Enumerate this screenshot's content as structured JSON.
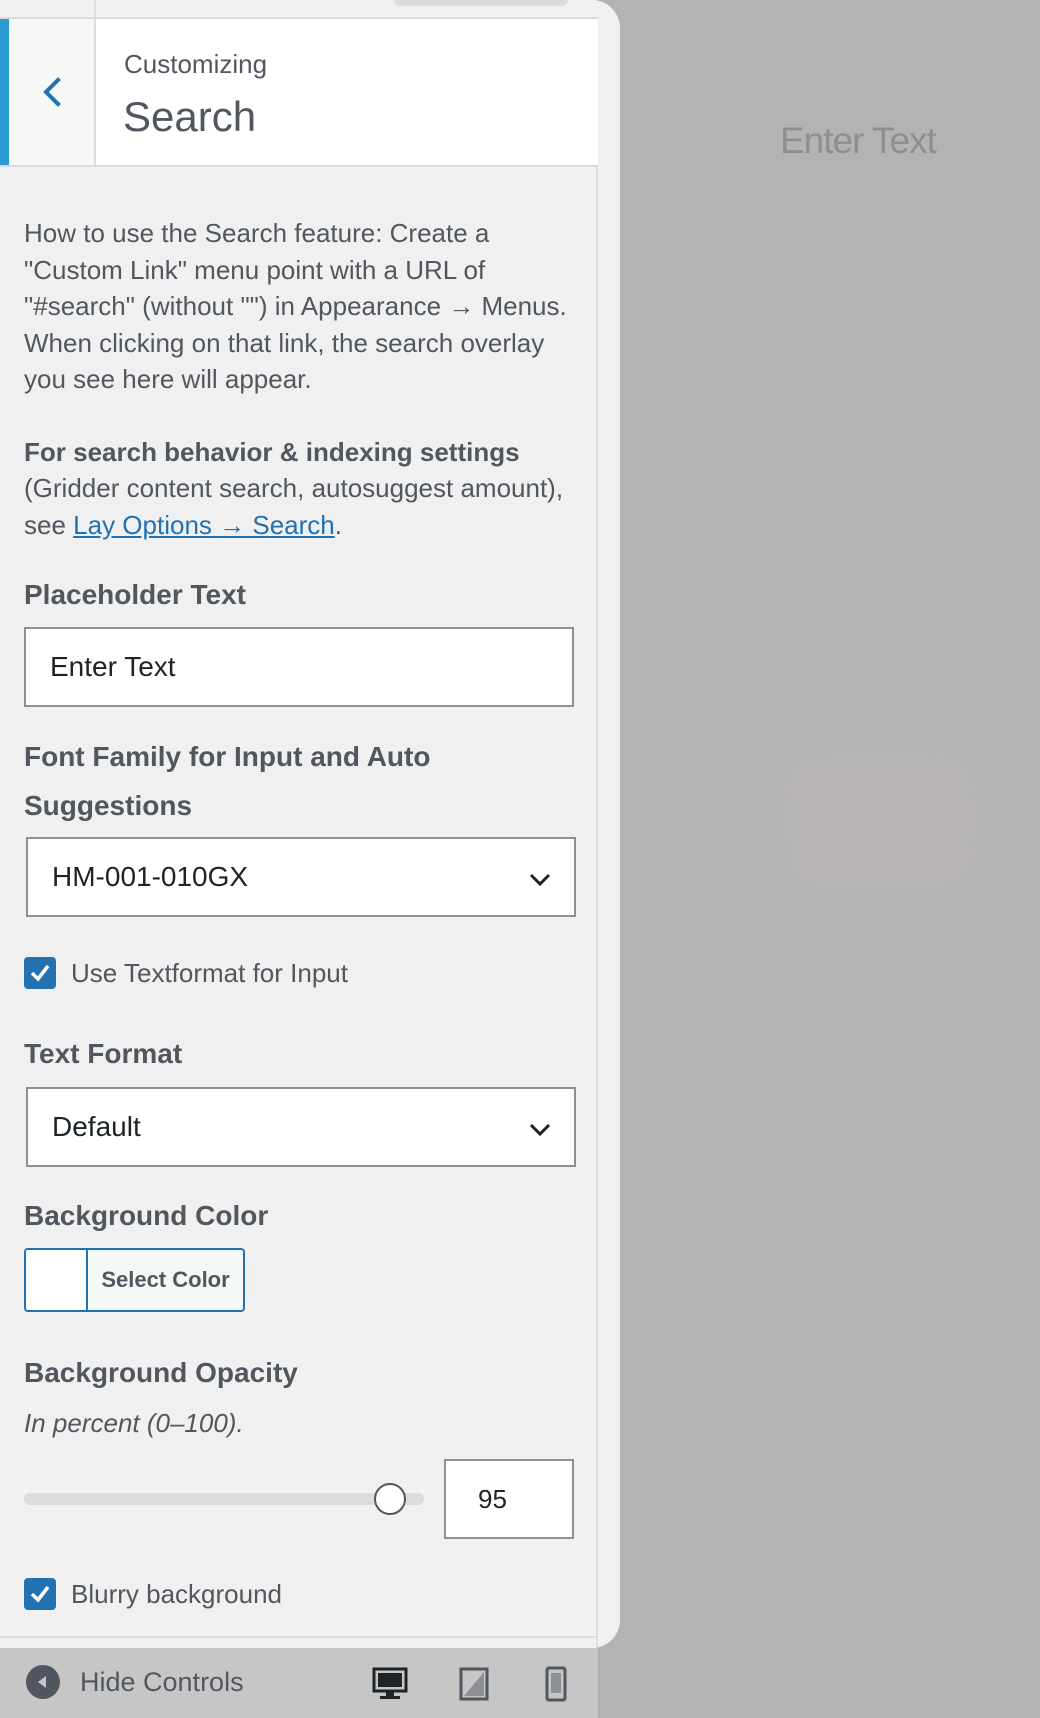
{
  "preview": {
    "placeholder_text": "Enter Text"
  },
  "header": {
    "pre_title": "Customizing",
    "title": "Search",
    "back_icon": "chevron-left-icon"
  },
  "description": {
    "usage": "How to use the Search feature: Create a \"Custom Link\" menu point with a URL of \"#search\" (without \"\") in Appearance → Menus. When clicking on that link, the search overlay you see here will appear.",
    "settings_bold": "For search behavior & indexing settings",
    "settings_rest": " (Gridder content search, autosuggest amount), see ",
    "settings_link": "Lay Options → Search",
    "settings_end": "."
  },
  "fields": {
    "placeholder_label": "Placeholder Text",
    "placeholder_value": "Enter Text",
    "font_family_label_line1": "Font Family for Input and Auto",
    "font_family_label_line2": "Suggestions",
    "font_family_value": "HM-001-010GX",
    "use_textformat_label": "Use Textformat for Input",
    "use_textformat_checked": true,
    "text_format_label": "Text Format",
    "text_format_value": "Default",
    "bg_color_label": "Background Color",
    "bg_color_button": "Select Color",
    "bg_color_value": "#ffffff",
    "bg_opacity_label": "Background Opacity",
    "bg_opacity_hint": "In percent (0–100).",
    "bg_opacity_value": "95",
    "blurry_label": "Blurry background",
    "blurry_checked": true
  },
  "footer": {
    "hide_controls": "Hide Controls",
    "devices": [
      "desktop-icon",
      "tablet-icon",
      "mobile-icon"
    ]
  },
  "colors": {
    "accent": "#2271b1",
    "active_border": "#2e9bd0",
    "panel_bg": "#f0f0f1",
    "preview_bg": "#b3b3b3"
  }
}
